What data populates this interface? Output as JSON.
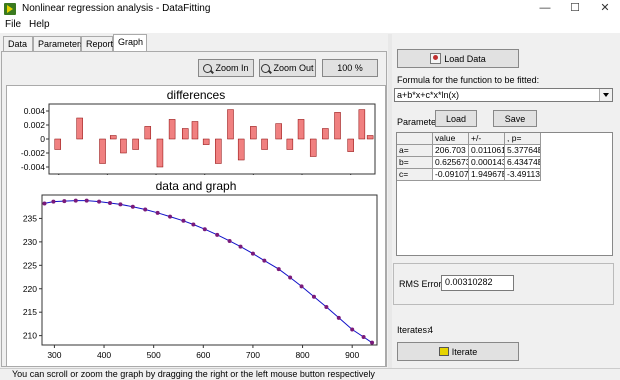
{
  "window": {
    "title": "Nonlinear regression analysis - DataFitting",
    "minimize": "—",
    "maximize": "☐",
    "close": "✕"
  },
  "menu": [
    "File",
    "Help"
  ],
  "tabs": [
    "Data",
    "Parameters",
    "Report",
    "Graph"
  ],
  "toolbar": {
    "zoom_in": "Zoom In",
    "zoom_out": "Zoom Out",
    "zoom_level": "100 %"
  },
  "plots": {
    "differences_title": "differences",
    "data_title": "data and graph"
  },
  "chart_data": [
    {
      "type": "bar",
      "title": "differences",
      "x": [
        298,
        343,
        390,
        412,
        433,
        458,
        483,
        508,
        533,
        560,
        580,
        603,
        628,
        653,
        675,
        700,
        723,
        752,
        775,
        798,
        823,
        848,
        873,
        900,
        923,
        940
      ],
      "values": [
        -0.0015,
        0.003,
        -0.0035,
        0.0005,
        -0.002,
        -0.0015,
        0.0018,
        -0.004,
        0.0028,
        0.0015,
        0.0025,
        -0.0008,
        -0.0035,
        0.0042,
        -0.003,
        0.0018,
        -0.0015,
        0.0022,
        -0.0015,
        0.0028,
        -0.0025,
        0.0015,
        0.0038,
        -0.0018,
        0.0042,
        0.0005
      ],
      "xticks": [
        300,
        400,
        500,
        600,
        700,
        800,
        900
      ],
      "yticks": [
        0.004,
        0.002,
        0,
        -0.002,
        -0.004
      ],
      "xlim": [
        280,
        950
      ],
      "ylim": [
        -0.005,
        0.005
      ],
      "bar_color": "#f08080"
    },
    {
      "type": "scatter",
      "title": "data and graph",
      "x": [
        280,
        298,
        320,
        343,
        365,
        390,
        412,
        433,
        458,
        483,
        508,
        533,
        560,
        580,
        603,
        628,
        653,
        675,
        700,
        723,
        752,
        775,
        798,
        823,
        848,
        873,
        900,
        923,
        940
      ],
      "y": [
        238.2,
        238.6,
        238.7,
        238.8,
        238.8,
        238.6,
        238.3,
        238.0,
        237.5,
        236.9,
        236.2,
        235.4,
        234.5,
        233.7,
        232.7,
        231.5,
        230.2,
        229.0,
        227.5,
        226.0,
        224.2,
        222.4,
        220.5,
        218.3,
        216.1,
        213.8,
        211.3,
        209.7,
        208.5
      ],
      "fit": "line",
      "xticks": [
        300,
        400,
        500,
        600,
        700,
        800,
        900
      ],
      "yticks": [
        235,
        230,
        225,
        220,
        215,
        210
      ],
      "xlim": [
        275,
        950
      ],
      "ylim": [
        208,
        240
      ],
      "line_color": "#1010c8",
      "point_color": "#7a1a7a"
    }
  ],
  "right": {
    "load_data": "Load Data",
    "formula_label": "Formula for the function to be fitted:",
    "formula_value": "a+b*x+c*x*ln(x)",
    "parameters_label": "Parameters:",
    "load_btn": "Load",
    "save_btn": "Save",
    "grid": {
      "headers": [
        "",
        "value",
        "+/-",
        ", p="
      ],
      "rows": [
        [
          "a=",
          "206.703",
          "0.011061",
          "5.37764E"
        ],
        [
          "b=",
          "0.625673",
          "0.000143",
          "6.43474E"
        ],
        [
          "c=",
          "-0.09107€",
          "1.94967E",
          "-3.49113E"
        ]
      ]
    },
    "rms_label": "RMS Error",
    "rms_value": "0.00310282",
    "iterates_label": "Iterates:",
    "iterates_value": "4",
    "iterate_btn": "Iterate"
  },
  "status": "You can scroll or zoom the graph by dragging the right or the left mouse button respectively"
}
